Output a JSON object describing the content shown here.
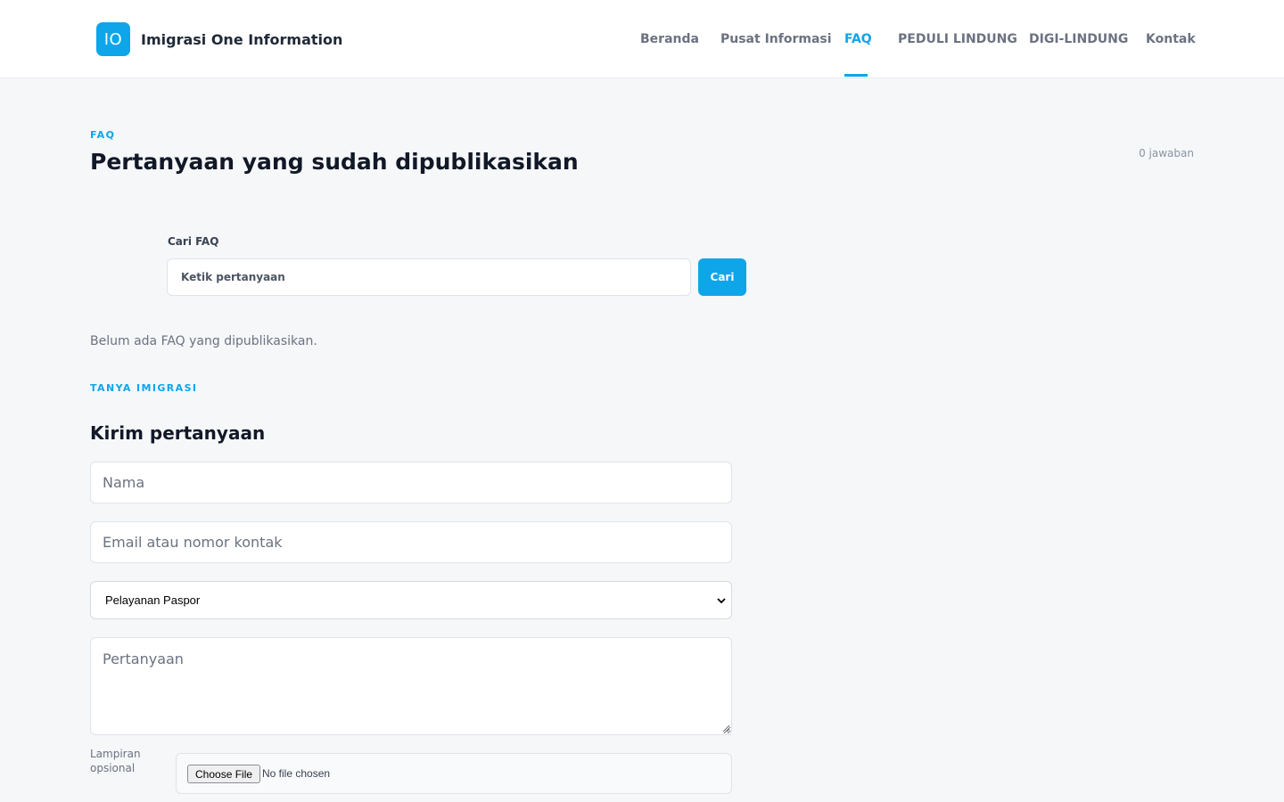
{
  "header": {
    "logo_mark": "IO",
    "brand_name": "Imigrasi One Information",
    "nav": [
      {
        "label": "Beranda",
        "active": false
      },
      {
        "label": "Pusat Informasi",
        "active": false
      },
      {
        "label": "FAQ",
        "active": true
      },
      {
        "label": "PEDULI LINDUNG",
        "active": false
      },
      {
        "label": "DIGI-LINDUNG",
        "active": false
      },
      {
        "label": "Kontak",
        "active": false
      }
    ]
  },
  "faq": {
    "eyebrow": "FAQ",
    "title": "Pertanyaan yang sudah dipublikasikan",
    "answer_count": "0 jawaban",
    "search_label": "Cari FAQ",
    "search_placeholder": "Ketik pertanyaan",
    "search_button": "Cari",
    "empty_message": "Belum ada FAQ yang dipublikasikan."
  },
  "ask": {
    "eyebrow": "TANYA IMIGRASI",
    "title": "Kirim pertanyaan",
    "name_placeholder": "Nama",
    "contact_placeholder": "Email atau nomor kontak",
    "category_selected": "Pelayanan Paspor",
    "question_placeholder": "Pertanyaan",
    "attachment_label": "Lampiran opsional",
    "file_button": "Choose File",
    "file_status": "No file chosen"
  },
  "colors": {
    "accent": "#0ea5e9",
    "background": "#f6f7f9",
    "text": "#1f2937",
    "muted": "#6b7280"
  },
  "icons": {
    "select_caret": "chevron-down-icon",
    "textarea_resize": "resize-handle-icon"
  }
}
